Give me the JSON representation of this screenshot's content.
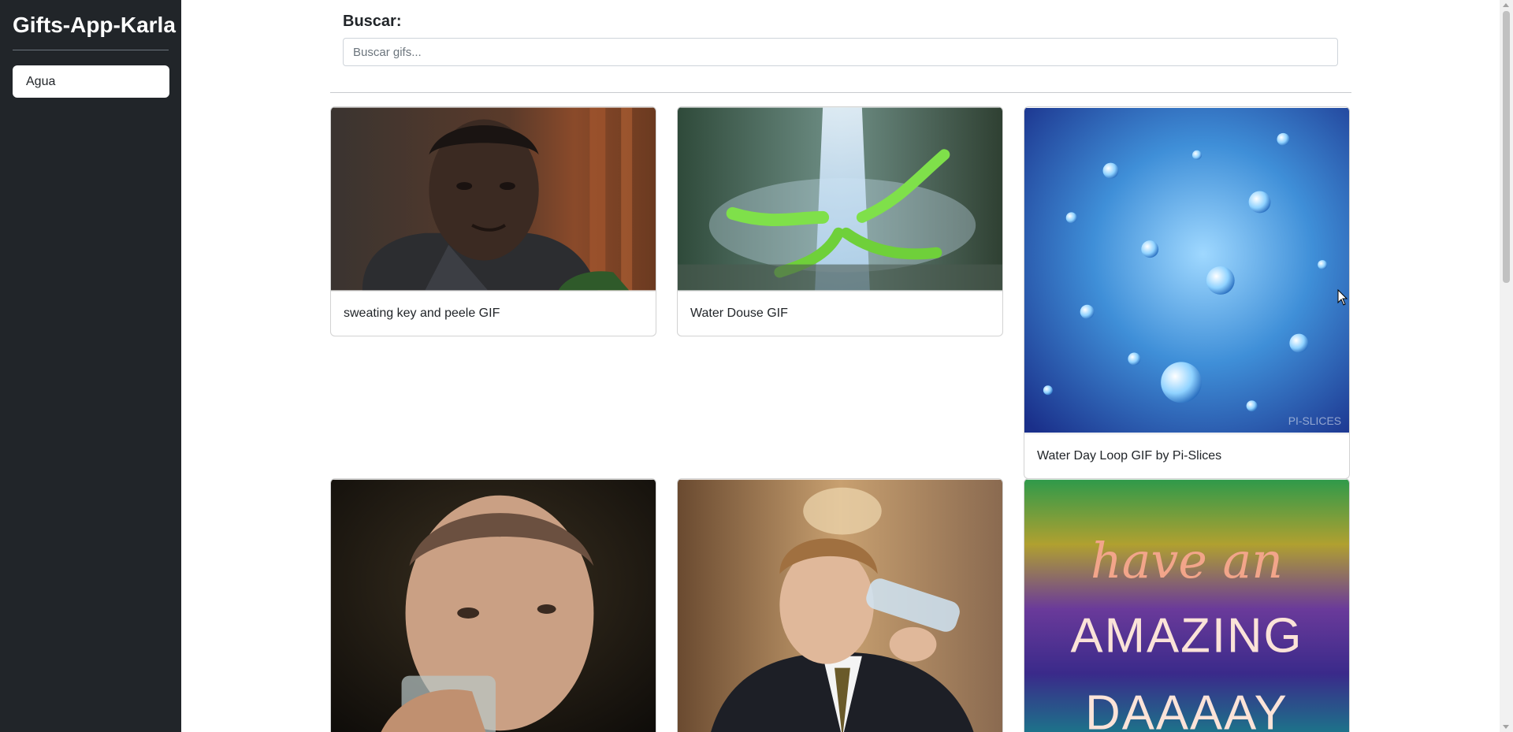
{
  "app_title": "Gifts-App-Karla",
  "sidebar": {
    "categories": [
      "Agua"
    ]
  },
  "search": {
    "label": "Buscar:",
    "placeholder": "Buscar gifs...",
    "value": ""
  },
  "gifs": [
    {
      "title": "sweating key and peele GIF"
    },
    {
      "title": "Water Douse GIF"
    },
    {
      "title": "Water Day Loop GIF by Pi-Slices",
      "watermark": "PI-SLICES"
    },
    {
      "title": ""
    },
    {
      "title": ""
    },
    {
      "title": "",
      "image_text": [
        "have an",
        "AMAZING",
        "DAAAAY"
      ]
    }
  ],
  "colors": {
    "sidebar_bg": "#212529",
    "text": "#212529",
    "border": "#ced4da"
  }
}
